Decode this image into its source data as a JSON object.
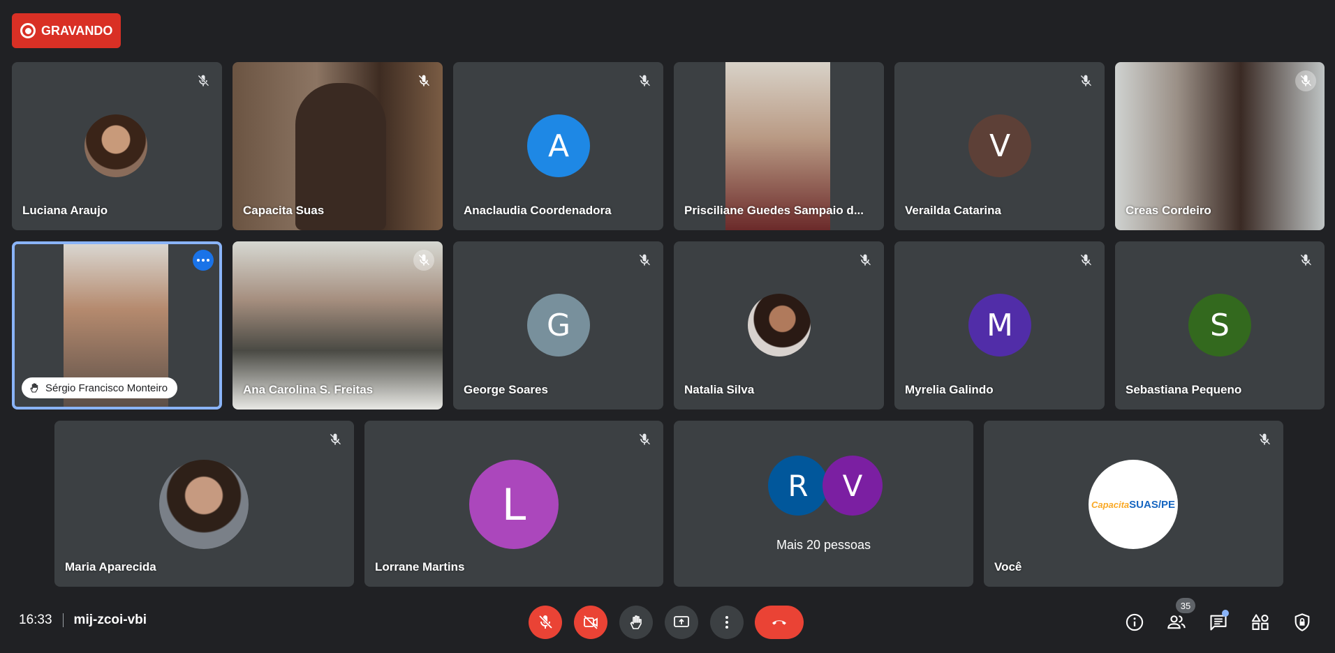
{
  "recording": {
    "label": "GRAVANDO"
  },
  "tiles": {
    "luciana": {
      "name": "Luciana Araujo"
    },
    "capacita": {
      "name": "Capacita Suas"
    },
    "anaclaudia": {
      "name": "Anaclaudia Coordenadora",
      "initial": "A",
      "color": "#1e88e5"
    },
    "prisciliane": {
      "name": "Prisciliane Guedes Sampaio d..."
    },
    "verailda": {
      "name": "Verailda Catarina",
      "initial": "V",
      "color": "#5d4037"
    },
    "creas": {
      "name": "Creas Cordeiro"
    },
    "sergio": {
      "name": "Sérgio Francisco Monteiro"
    },
    "ana_carolina": {
      "name": "Ana Carolina S. Freitas"
    },
    "george": {
      "name": "George Soares",
      "initial": "G",
      "color": "#78909c"
    },
    "natalia": {
      "name": "Natalia Silva"
    },
    "myrelia": {
      "name": "Myrelia Galindo",
      "initial": "M",
      "color": "#512da8"
    },
    "sebastiana": {
      "name": "Sebastiana Pequeno",
      "initial": "S",
      "color": "#33691e"
    },
    "maria": {
      "name": "Maria Aparecida"
    },
    "lorrane": {
      "name": "Lorrane Martins",
      "initial": "L",
      "color": "#ab47bc"
    },
    "more": {
      "label": "Mais 20 pessoas",
      "initial_1": "R",
      "color_1": "#01579b",
      "initial_2": "V",
      "color_2": "#7b1fa2"
    },
    "voce": {
      "name": "Você",
      "logo_text_1": "Capacita",
      "logo_text_2": "SUAS/PE"
    }
  },
  "bottom": {
    "time": "16:33",
    "meeting_code": "mij-zcoi-vbi",
    "participants_count": "35"
  },
  "colors": {
    "accent": "#8ab4f8",
    "danger": "#ea4335",
    "tile": "#3c4043",
    "background": "#202124"
  }
}
